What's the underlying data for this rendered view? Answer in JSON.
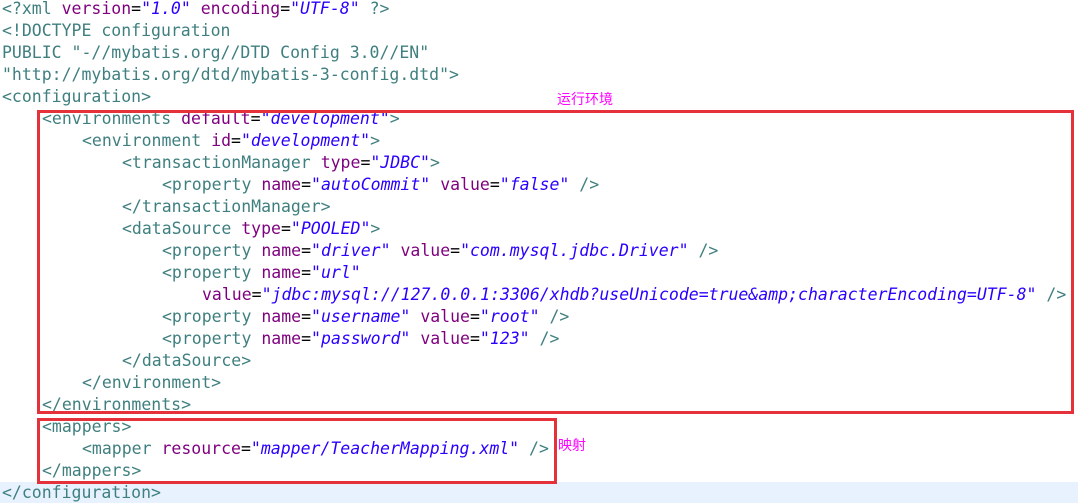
{
  "code_lines": [
    {
      "indent": 0,
      "tokens": [
        {
          "t": "tag",
          "v": "<?xml "
        },
        {
          "t": "attr",
          "v": "version"
        },
        {
          "t": "punc",
          "v": "="
        },
        {
          "t": "val",
          "v": "\"1.0\""
        },
        {
          "t": "tag",
          "v": " "
        },
        {
          "t": "attr",
          "v": "encoding"
        },
        {
          "t": "punc",
          "v": "="
        },
        {
          "t": "val",
          "v": "\"UTF-8\""
        },
        {
          "t": "tag",
          "v": " ?>"
        }
      ]
    },
    {
      "indent": 0,
      "tokens": [
        {
          "t": "tag",
          "v": "<!DOCTYPE configuration"
        }
      ]
    },
    {
      "indent": 0,
      "tokens": [
        {
          "t": "doctype-text",
          "v": "PUBLIC "
        },
        {
          "t": "doctype-str",
          "v": "\"-//mybatis.org//DTD Config 3.0//EN\""
        }
      ]
    },
    {
      "indent": 0,
      "tokens": [
        {
          "t": "doctype-str",
          "v": "\"http://mybatis.org/dtd/mybatis-3-config.dtd\""
        },
        {
          "t": "tag",
          "v": ">"
        }
      ]
    },
    {
      "indent": 0,
      "tokens": [
        {
          "t": "tag",
          "v": "<configuration>"
        }
      ]
    },
    {
      "indent": 1,
      "tokens": [
        {
          "t": "tag",
          "v": "<environments "
        },
        {
          "t": "attr",
          "v": "default"
        },
        {
          "t": "punc",
          "v": "="
        },
        {
          "t": "val",
          "v": "\"development\""
        },
        {
          "t": "tag",
          "v": ">"
        }
      ]
    },
    {
      "indent": 2,
      "tokens": [
        {
          "t": "tag",
          "v": "<environment "
        },
        {
          "t": "attr",
          "v": "id"
        },
        {
          "t": "punc",
          "v": "="
        },
        {
          "t": "val",
          "v": "\"development\""
        },
        {
          "t": "tag",
          "v": ">"
        }
      ]
    },
    {
      "indent": 3,
      "tokens": [
        {
          "t": "tag",
          "v": "<transactionManager "
        },
        {
          "t": "attr",
          "v": "type"
        },
        {
          "t": "punc",
          "v": "="
        },
        {
          "t": "val",
          "v": "\"JDBC\""
        },
        {
          "t": "tag",
          "v": ">"
        }
      ]
    },
    {
      "indent": 4,
      "tokens": [
        {
          "t": "tag",
          "v": "<property "
        },
        {
          "t": "attr",
          "v": "name"
        },
        {
          "t": "punc",
          "v": "="
        },
        {
          "t": "val",
          "v": "\"autoCommit\""
        },
        {
          "t": "tag",
          "v": " "
        },
        {
          "t": "attr",
          "v": "value"
        },
        {
          "t": "punc",
          "v": "="
        },
        {
          "t": "val",
          "v": "\"false\""
        },
        {
          "t": "tag",
          "v": " />"
        }
      ]
    },
    {
      "indent": 3,
      "tokens": [
        {
          "t": "tag",
          "v": "</transactionManager>"
        }
      ]
    },
    {
      "indent": 3,
      "tokens": [
        {
          "t": "tag",
          "v": "<dataSource "
        },
        {
          "t": "attr",
          "v": "type"
        },
        {
          "t": "punc",
          "v": "="
        },
        {
          "t": "val",
          "v": "\"POOLED\""
        },
        {
          "t": "tag",
          "v": ">"
        }
      ]
    },
    {
      "indent": 4,
      "tokens": [
        {
          "t": "tag",
          "v": "<property "
        },
        {
          "t": "attr",
          "v": "name"
        },
        {
          "t": "punc",
          "v": "="
        },
        {
          "t": "val",
          "v": "\"driver\""
        },
        {
          "t": "tag",
          "v": " "
        },
        {
          "t": "attr",
          "v": "value"
        },
        {
          "t": "punc",
          "v": "="
        },
        {
          "t": "val",
          "v": "\"com.mysql.jdbc.Driver\""
        },
        {
          "t": "tag",
          "v": " />"
        }
      ]
    },
    {
      "indent": 4,
      "tokens": [
        {
          "t": "tag",
          "v": "<property "
        },
        {
          "t": "attr",
          "v": "name"
        },
        {
          "t": "punc",
          "v": "="
        },
        {
          "t": "val",
          "v": "\"url\""
        }
      ]
    },
    {
      "indent": 5,
      "tokens": [
        {
          "t": "attr",
          "v": "value"
        },
        {
          "t": "punc",
          "v": "="
        },
        {
          "t": "val",
          "v": "\"jdbc:mysql://127.0.0.1:3306/xhdb?useUnicode=true&amp;characterEncoding=UTF-8\""
        },
        {
          "t": "tag",
          "v": " />"
        }
      ]
    },
    {
      "indent": 4,
      "tokens": [
        {
          "t": "tag",
          "v": "<property "
        },
        {
          "t": "attr",
          "v": "name"
        },
        {
          "t": "punc",
          "v": "="
        },
        {
          "t": "val",
          "v": "\"username\""
        },
        {
          "t": "tag",
          "v": " "
        },
        {
          "t": "attr",
          "v": "value"
        },
        {
          "t": "punc",
          "v": "="
        },
        {
          "t": "val",
          "v": "\"root\""
        },
        {
          "t": "tag",
          "v": " />"
        }
      ]
    },
    {
      "indent": 4,
      "tokens": [
        {
          "t": "tag",
          "v": "<property "
        },
        {
          "t": "attr",
          "v": "name"
        },
        {
          "t": "punc",
          "v": "="
        },
        {
          "t": "val",
          "v": "\"password\""
        },
        {
          "t": "tag",
          "v": " "
        },
        {
          "t": "attr",
          "v": "value"
        },
        {
          "t": "punc",
          "v": "="
        },
        {
          "t": "val",
          "v": "\"123\""
        },
        {
          "t": "tag",
          "v": " />"
        }
      ]
    },
    {
      "indent": 3,
      "tokens": [
        {
          "t": "tag",
          "v": "</dataSource>"
        }
      ]
    },
    {
      "indent": 2,
      "tokens": [
        {
          "t": "tag",
          "v": "</environment>"
        }
      ]
    },
    {
      "indent": 1,
      "tokens": [
        {
          "t": "tag",
          "v": "</environments>"
        }
      ]
    },
    {
      "indent": 1,
      "tokens": [
        {
          "t": "tag",
          "v": "<mappers>"
        }
      ]
    },
    {
      "indent": 2,
      "tokens": [
        {
          "t": "tag",
          "v": "<mapper "
        },
        {
          "t": "attr",
          "v": "resource"
        },
        {
          "t": "punc",
          "v": "="
        },
        {
          "t": "val",
          "v": "\"mapper/TeacherMapping.xml\""
        },
        {
          "t": "tag",
          "v": " />"
        }
      ]
    },
    {
      "indent": 1,
      "tokens": [
        {
          "t": "tag",
          "v": "</mappers>"
        }
      ]
    },
    {
      "indent": 0,
      "tokens": [
        {
          "t": "tag",
          "v": "</configuration>"
        }
      ]
    }
  ],
  "annotations": {
    "environments_label": "运行环境",
    "mappers_label": "映射"
  },
  "colors": {
    "tag": "#3f7f7f",
    "attribute": "#7f007f",
    "value": "#2a00ff",
    "box": "#e5323a",
    "annotation": "#ff00ff",
    "current_line": "#e8f2fe"
  }
}
